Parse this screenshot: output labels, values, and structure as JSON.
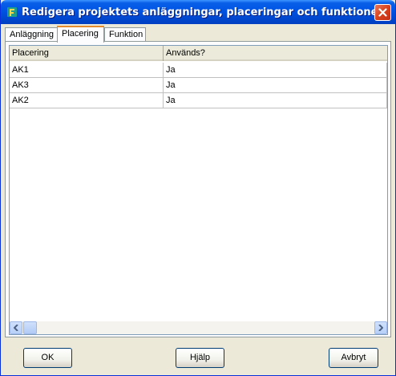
{
  "window": {
    "title": "Redigera projektets anläggningar, placeringar och funktioner"
  },
  "tabs": [
    {
      "label": "Anläggning",
      "active": false
    },
    {
      "label": "Placering",
      "active": true
    },
    {
      "label": "Funktion",
      "active": false
    }
  ],
  "grid": {
    "columns": [
      "Placering",
      "Används?"
    ],
    "rows": [
      [
        "AK1",
        "Ja"
      ],
      [
        "AK3",
        "Ja"
      ],
      [
        "AK2",
        "Ja"
      ]
    ]
  },
  "buttons": {
    "ok": "OK",
    "help": "Hjälp",
    "cancel": "Avbryt"
  },
  "colors": {
    "titlebar": "#0055e5",
    "active_tab_accent": "#e68b2c",
    "close_button": "#d8431c"
  }
}
